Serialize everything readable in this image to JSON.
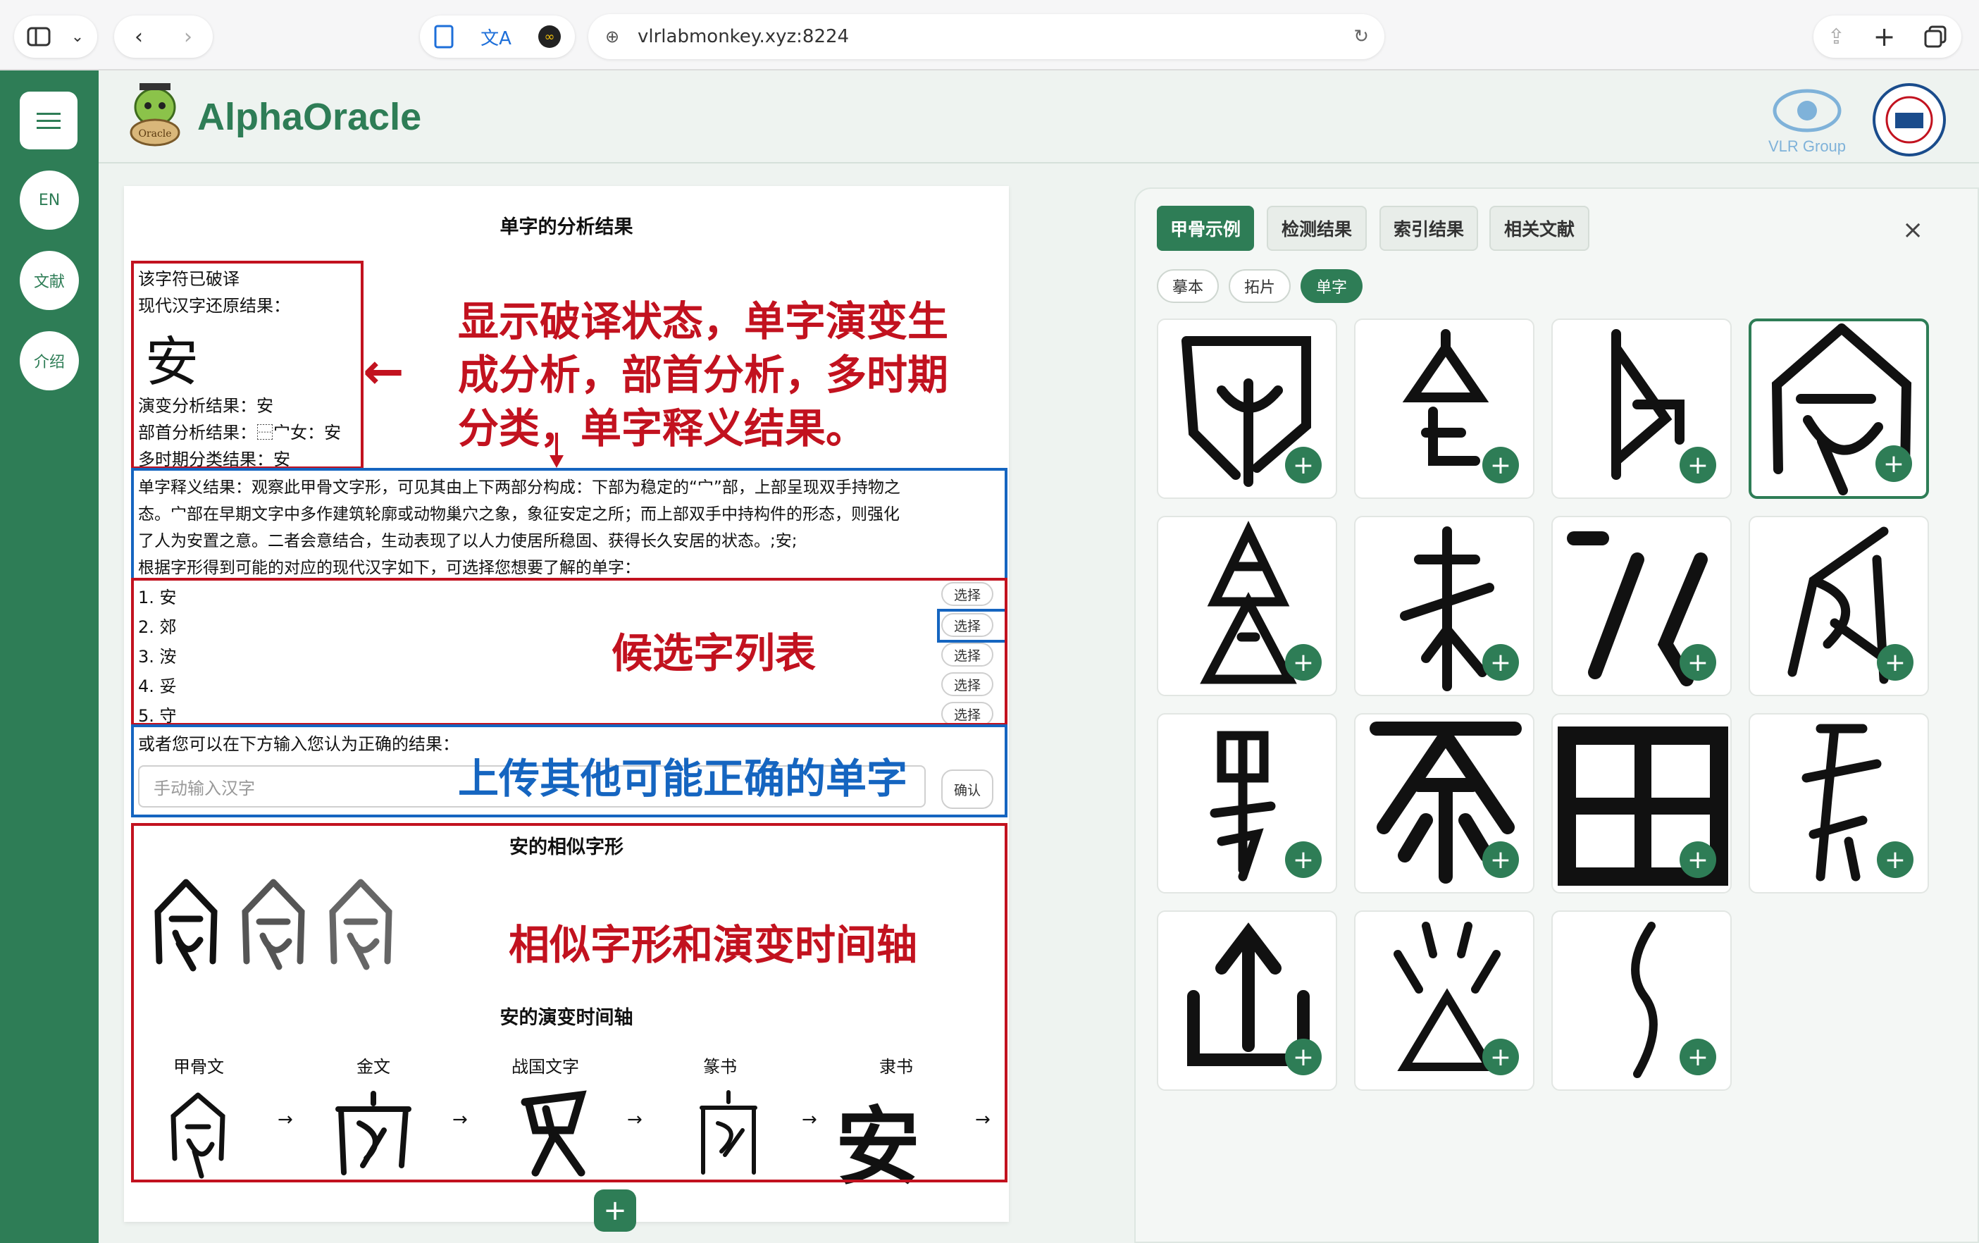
{
  "browser": {
    "url": "vlrlabmonkey.xyz:8224"
  },
  "app": {
    "brand": "AlphaOracle",
    "logo_text": "Oracle",
    "vlr_label": "VLR Group",
    "sidebar": [
      {
        "label": "EN"
      },
      {
        "label": "文献"
      },
      {
        "label": "介绍"
      }
    ]
  },
  "left": {
    "title": "单字的分析结果",
    "status": "该字符已破译",
    "restore_label": "现代汉字还原结果：",
    "big_char": "安",
    "evolution": "演变分析结果：安",
    "radical": "部首分析结果：⿱宀女：安",
    "period": "多时期分类结果：安",
    "meaning_lines": [
      "单字释义结果：观察此甲骨文字形，可见其由上下两部分构成：下部为稳定的“宀”部，上部呈现双手持物之",
      "态。宀部在早期文字中多作建筑轮廓或动物巢穴之象，象征安定之所；而上部双手中持构件的形态，则强化",
      "了人为安置之意。二者会意结合，生动表现了以人力使居所稳固、获得长久安居的状态。;安;",
      "根据字形得到可能的对应的现代汉字如下，可选择您想要了解的单字："
    ],
    "candidates": [
      {
        "text": "1. 安",
        "button": "选择"
      },
      {
        "text": "2. 郊",
        "button": "选择"
      },
      {
        "text": "3. 洝",
        "button": "选择"
      },
      {
        "text": "4. 妥",
        "button": "选择"
      },
      {
        "text": "5. 守",
        "button": "选择"
      }
    ],
    "manual_label": "或者您可以在下方输入您认为正确的结果：",
    "manual_placeholder": "手动输入汉字",
    "confirm": "确认",
    "similar_title": "安的相似字形",
    "timeline_title": "安的演变时间轴",
    "timeline": [
      "甲骨文",
      "金文",
      "战国文字",
      "篆书",
      "隶书"
    ],
    "timeline_final": "安",
    "arrow": "→",
    "plus": "+"
  },
  "annotations": {
    "status_note": [
      "显示破译状态，单字演变生",
      "成分析，部首分析，多时期",
      "分类，单字释义结果。"
    ],
    "candidates_note": "候选字列表",
    "upload_note": "上传其他可能正确的单字",
    "similar_note": "相似字形和演变时间轴",
    "arrow": "←"
  },
  "right": {
    "tabs": [
      {
        "label": "甲骨示例",
        "active": true
      },
      {
        "label": "检测结果",
        "active": false
      },
      {
        "label": "索引结果",
        "active": false
      },
      {
        "label": "相关文献",
        "active": false
      }
    ],
    "subtabs": [
      {
        "label": "摹本",
        "active": false
      },
      {
        "label": "拓片",
        "active": false
      },
      {
        "label": "单字",
        "active": true
      }
    ],
    "close": "×",
    "plus": "+",
    "card_count": 15
  },
  "colors": {
    "brand": "#2e7d56",
    "annotation_red": "#c2121f",
    "annotation_blue": "#1565c0"
  }
}
